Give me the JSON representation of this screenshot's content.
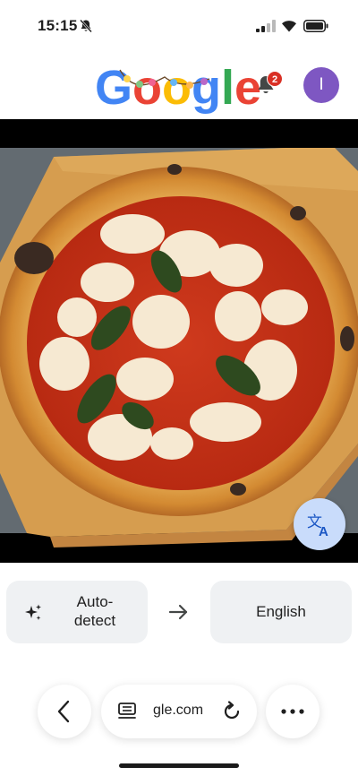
{
  "status_bar": {
    "time": "15:15",
    "icons": [
      "bell-slash-icon",
      "cellular-signal-icon",
      "wifi-icon",
      "battery-icon"
    ]
  },
  "header": {
    "logo_alt": "Google",
    "notification_count": "2",
    "avatar_initial": "I"
  },
  "image": {
    "subject_icon": "pizza-photo"
  },
  "translate": {
    "fab_icon": "translate-icon",
    "source_language": "Auto-\ndetect",
    "arrow_icon": "arrow-right-icon",
    "target_language": "English"
  },
  "browser_bar": {
    "url": "gle.com",
    "back_icon": "chevron-left-icon",
    "reader_icon": "reader-icon",
    "reload_icon": "reload-icon",
    "more_icon": "more-horizontal-icon"
  },
  "colors": {
    "accent_fab": "#c9dcfb",
    "avatar": "#7e57c2",
    "badge": "#d93025",
    "chip_bg": "#eff1f3"
  }
}
